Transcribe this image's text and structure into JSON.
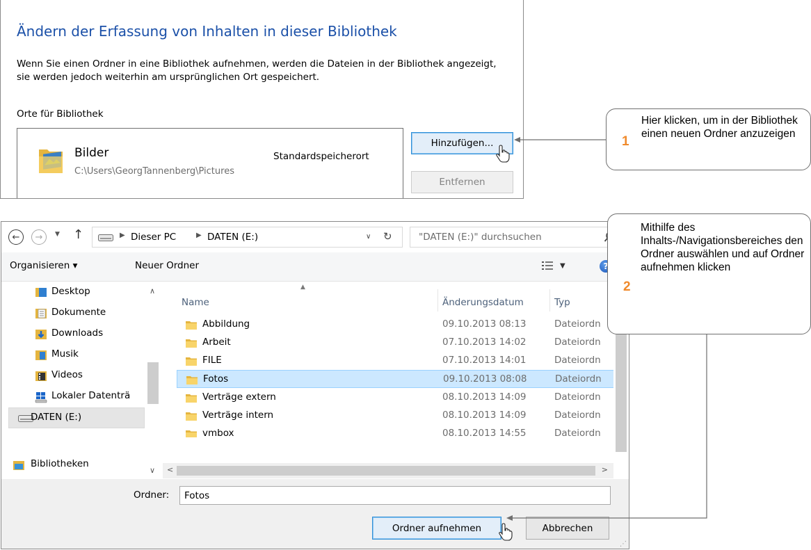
{
  "library_dialog": {
    "title": "Ändern der Erfassung von Inhalten in dieser Bibliothek",
    "description": "Wenn Sie einen Ordner in eine Bibliothek aufnehmen, werden die Dateien in der Bibliothek angezeigt, sie werden jedoch weiterhin am ursprünglichen Ort gespeichert.",
    "places_label": "Orte für Bibliothek",
    "folder": {
      "name": "Bilder",
      "path": "C:\\Users\\GeorgTannenberg\\Pictures",
      "default_label": "Standardspeicherort"
    },
    "add_button": "Hinzufügen...",
    "remove_button": "Entfernen"
  },
  "file_dialog": {
    "breadcrumb": [
      "Dieser PC",
      "DATEN (E:)"
    ],
    "search_placeholder": "\"DATEN (E:)\" durchsuchen",
    "toolbar": {
      "organize": "Organisieren ▾",
      "new_folder": "Neuer Ordner"
    },
    "nav_items": [
      {
        "label": "Desktop",
        "icon": "desktop-icon"
      },
      {
        "label": "Dokumente",
        "icon": "documents-icon"
      },
      {
        "label": "Downloads",
        "icon": "downloads-icon"
      },
      {
        "label": "Musik",
        "icon": "music-icon"
      },
      {
        "label": "Videos",
        "icon": "videos-icon"
      },
      {
        "label": "Lokaler Datenträ",
        "icon": "local-disk-icon"
      },
      {
        "label": "DATEN (E:)",
        "icon": "drive-icon"
      },
      {
        "label": "Bibliotheken",
        "icon": "libraries-icon"
      }
    ],
    "columns": {
      "name": "Name",
      "date": "Änderungsdatum",
      "type": "Typ"
    },
    "files": [
      {
        "name": "Abbildung",
        "date": "09.10.2013 08:13",
        "type": "Dateiordn"
      },
      {
        "name": "Arbeit",
        "date": "07.10.2013 14:02",
        "type": "Dateiordn"
      },
      {
        "name": "FILE",
        "date": "07.10.2013 14:01",
        "type": "Dateiordn"
      },
      {
        "name": "Fotos",
        "date": "09.10.2013 08:08",
        "type": "Dateiordn"
      },
      {
        "name": "Verträge extern",
        "date": "08.10.2013 14:09",
        "type": "Dateiordn"
      },
      {
        "name": "Verträge intern",
        "date": "08.10.2013 14:09",
        "type": "Dateiordn"
      },
      {
        "name": "vmbox",
        "date": "08.10.2013 14:55",
        "type": "Dateiordn"
      }
    ],
    "folder_label": "Ordner:",
    "folder_value": "Fotos",
    "include_button": "Ordner aufnehmen",
    "cancel_button": "Abbrechen"
  },
  "callouts": [
    {
      "number": "1",
      "text": "Hier klicken, um in der Bibliothek einen neuen Ordner anzuzeigen"
    },
    {
      "number": "2",
      "text": "Mithilfe des Inhalts-/Navigationsbereiches den Ordner auswählen und auf Ordner aufnehmen klicken"
    }
  ],
  "colors": {
    "title_blue": "#1b50a8",
    "selection": "#cce8ff",
    "callout_number": "#f08a2c",
    "folder_yellow": "#f6c94f"
  }
}
